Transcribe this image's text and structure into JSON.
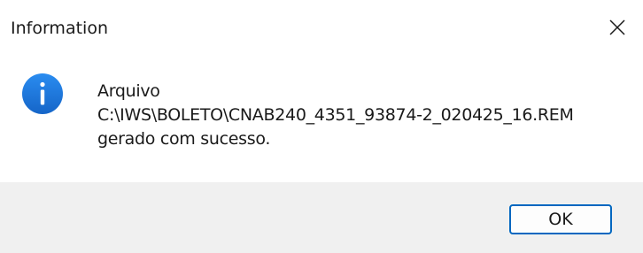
{
  "window": {
    "title": "Information",
    "close_icon": "close-icon"
  },
  "content": {
    "icon": "info-icon",
    "icon_color": "#1a73d9",
    "message_lines": [
      "Arquivo",
      "C:\\IWS\\BOLETO\\CNAB240_4351_93874-2_020425_16.REM",
      "gerado com sucesso."
    ]
  },
  "footer": {
    "ok_label": "OK",
    "accent_color": "#0067c0"
  }
}
